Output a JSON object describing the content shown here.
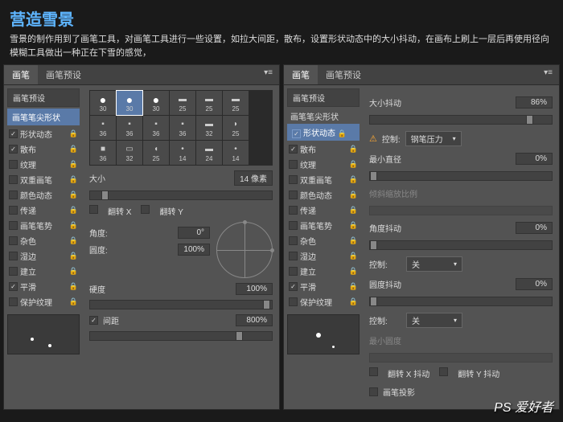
{
  "header": {
    "title": "营造雪景",
    "desc": "雪景的制作用到了画笔工具，对画笔工具进行一些设置，如拉大间距，散布，设置形状动态中的大小抖动，在画布上刷上一层后再使用径向模糊工具做出一种正在下雪的感觉，"
  },
  "tabs": {
    "brush": "画笔",
    "presets": "画笔预设"
  },
  "sidebar": {
    "head": "画笔预设",
    "active": "画笔笔尖形状",
    "items": [
      {
        "label": "形状动态",
        "checked": true
      },
      {
        "label": "散布",
        "checked": true
      },
      {
        "label": "纹理",
        "checked": false
      },
      {
        "label": "双重画笔",
        "checked": false
      },
      {
        "label": "颜色动态",
        "checked": false
      },
      {
        "label": "传递",
        "checked": false
      },
      {
        "label": "画笔笔势",
        "checked": false
      },
      {
        "label": "杂色",
        "checked": false
      },
      {
        "label": "湿边",
        "checked": false
      },
      {
        "label": "建立",
        "checked": false
      },
      {
        "label": "平滑",
        "checked": true
      },
      {
        "label": "保护纹理",
        "checked": false
      }
    ]
  },
  "brushes": {
    "row1": [
      "30",
      "30",
      "30",
      "25",
      "25",
      "25"
    ],
    "row2": [
      "36",
      "36",
      "36",
      "36",
      "32",
      "25"
    ],
    "row3": [
      "36",
      "32",
      "25",
      "14",
      "24",
      "14"
    ]
  },
  "left": {
    "size_label": "大小",
    "size_val": "14 像素",
    "flipx": "翻转 X",
    "flipy": "翻转 Y",
    "angle_label": "角度:",
    "angle_val": "0°",
    "round_label": "圆度:",
    "round_val": "100%",
    "hard_label": "硬度",
    "hard_val": "100%",
    "spacing_cb": true,
    "spacing_label": "间距",
    "spacing_val": "800%"
  },
  "right": {
    "jitter_label": "大小抖动",
    "jitter_val": "86%",
    "control_label": "控制:",
    "control_val": "钢笔压力",
    "min_dia_label": "最小直径",
    "min_dia_val": "0%",
    "tilt_label": "倾斜缩放比例",
    "angle_jitter_label": "角度抖动",
    "angle_jitter_val": "0%",
    "control2_val": "关",
    "round_jitter_label": "圆度抖动",
    "round_jitter_val": "0%",
    "control3_val": "关",
    "min_round_label": "最小圆度",
    "flipx_jitter": "翻转 X 抖动",
    "flipy_jitter": "翻转 Y 抖动",
    "brush_proj": "画笔投影"
  },
  "watermark": "PS 爱好者"
}
